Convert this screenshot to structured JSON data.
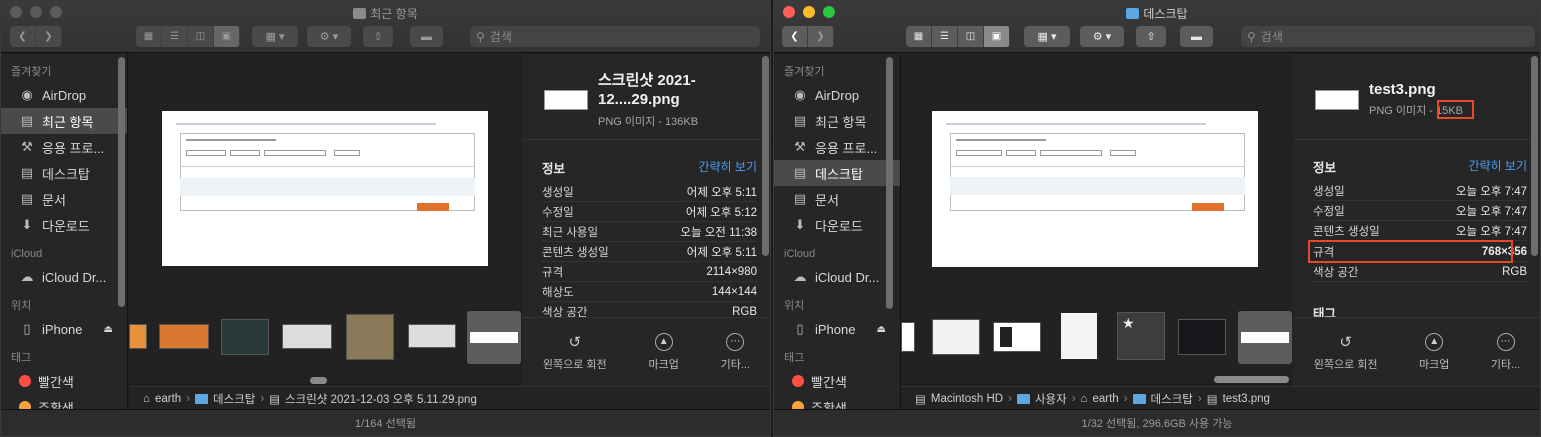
{
  "left": {
    "window_title": "최근 항목",
    "search_placeholder": "검색",
    "sidebar": {
      "favorites_header": "즐겨찾기",
      "favorites": [
        {
          "label": "AirDrop",
          "icon": "airdrop-icon"
        },
        {
          "label": "최근 항목",
          "icon": "recents-icon",
          "selected": true
        },
        {
          "label": "응용 프로...",
          "icon": "applications-icon"
        },
        {
          "label": "데스크탑",
          "icon": "desktop-icon"
        },
        {
          "label": "문서",
          "icon": "document-icon"
        },
        {
          "label": "다운로드",
          "icon": "downloads-icon"
        }
      ],
      "icloud_header": "iCloud",
      "icloud": [
        {
          "label": "iCloud Dr...",
          "icon": "cloud-icon"
        }
      ],
      "locations_header": "위치",
      "locations": [
        {
          "label": "iPhone",
          "icon": "iphone-icon"
        }
      ],
      "tags_header": "태그",
      "tags": [
        {
          "label": "빨간색",
          "color": "#ff4f44"
        },
        {
          "label": "주황색",
          "color": "#f7a23a"
        }
      ]
    },
    "info": {
      "filename": "스크린샷 2021-12....29.png",
      "kind": "PNG 이미지 - 136KB",
      "section": "정보",
      "link": "간략히 보기",
      "rows": [
        {
          "k": "생성일",
          "v": "어제 오후 5:11"
        },
        {
          "k": "수정일",
          "v": "어제 오후 5:12"
        },
        {
          "k": "최근 사용일",
          "v": "오늘 오전 11:38"
        },
        {
          "k": "콘텐츠 생성일",
          "v": "어제 오후 5:11"
        },
        {
          "k": "규격",
          "v": "2114×980"
        },
        {
          "k": "해상도",
          "v": "144×144"
        },
        {
          "k": "색상 공간",
          "v": "RGB"
        }
      ]
    },
    "actions": [
      "왼쪽으로 회전",
      "마크업",
      "기타..."
    ],
    "path": [
      "earth",
      "데스크탑",
      "스크린샷 2021-12-03 오후 5.11.29.png"
    ],
    "status": "1/164 선택됨"
  },
  "right": {
    "window_title": "데스크탑",
    "search_placeholder": "검색",
    "sidebar": {
      "favorites_header": "즐겨찾기",
      "favorites": [
        {
          "label": "AirDrop",
          "icon": "airdrop-icon"
        },
        {
          "label": "최근 항목",
          "icon": "recents-icon"
        },
        {
          "label": "응용 프로...",
          "icon": "applications-icon"
        },
        {
          "label": "데스크탑",
          "icon": "desktop-icon",
          "selected": true
        },
        {
          "label": "문서",
          "icon": "document-icon"
        },
        {
          "label": "다운로드",
          "icon": "downloads-icon"
        }
      ],
      "icloud_header": "iCloud",
      "icloud": [
        {
          "label": "iCloud Dr...",
          "icon": "cloud-icon"
        }
      ],
      "locations_header": "위치",
      "locations": [
        {
          "label": "iPhone",
          "icon": "iphone-icon"
        }
      ],
      "tags_header": "태그",
      "tags": [
        {
          "label": "빨간색",
          "color": "#ff4f44"
        },
        {
          "label": "주황색",
          "color": "#f7a23a"
        }
      ]
    },
    "info": {
      "filename": "test3.png",
      "kind_prefix": "PNG 이미지 - ",
      "kind_size": "15KB",
      "section": "정보",
      "link": "간략히 보기",
      "rows": [
        {
          "k": "생성일",
          "v": "오늘 오후 7:47"
        },
        {
          "k": "수정일",
          "v": "오늘 오후 7:47"
        },
        {
          "k": "콘텐츠 생성일",
          "v": "오늘 오후 7:47"
        },
        {
          "k": "규격",
          "v": "768×356"
        },
        {
          "k": "색상 공간",
          "v": "RGB"
        }
      ],
      "tags_section": "태그"
    },
    "actions": [
      "왼쪽으로 회전",
      "마크업",
      "기타..."
    ],
    "path": [
      "Macintosh HD",
      "사용자",
      "earth",
      "데스크탑",
      "test3.png"
    ],
    "status": "1/32 선택됨, 296.6GB 사용 가능"
  }
}
